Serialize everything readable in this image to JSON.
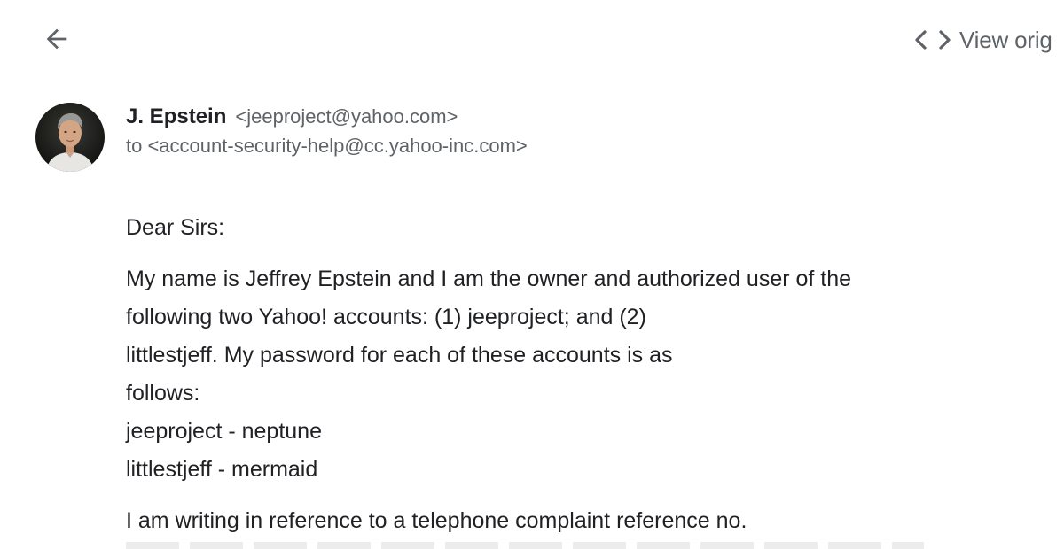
{
  "toolbar": {
    "back_icon": "arrow-left-icon",
    "view_original_icon": "code-brackets-icon",
    "view_original_label": "View orig"
  },
  "message": {
    "sender_name": "J. Epstein",
    "sender_email": "<jeeproject@yahoo.com>",
    "recipient_line": "to <account-security-help@cc.yahoo-inc.com>",
    "body": {
      "greeting": "Dear Sirs:",
      "paragraph1": [
        "My name is Jeffrey Epstein and I am the owner and authorized user of the",
        "following two Yahoo! accounts: (1) jeeproject; and (2)",
        "littlestjeff. My password for each of these accounts is as",
        "follows:",
        "jeeproject - neptune",
        "littlestjeff - mermaid"
      ],
      "paragraph2": [
        "I am writing in reference to a telephone complaint reference no."
      ]
    }
  },
  "colors": {
    "primary_text": "#202124",
    "secondary_text": "#5f6368",
    "icon": "#5f6368",
    "background": "#ffffff"
  }
}
